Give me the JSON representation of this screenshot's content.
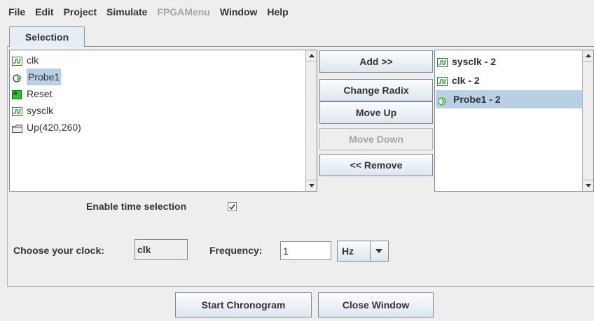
{
  "menu": [
    "File",
    "Edit",
    "Project",
    "Simulate",
    "FPGAMenu",
    "Window",
    "Help"
  ],
  "menu_disabled": [
    "FPGAMenu"
  ],
  "tab": {
    "label": "Selection"
  },
  "left_list": {
    "items": [
      {
        "label": "clk",
        "icon": "clock-signal-icon",
        "selected": false
      },
      {
        "label": "Probe1",
        "icon": "probe-icon",
        "selected": true
      },
      {
        "label": "Reset",
        "icon": "reset-icon",
        "selected": false
      },
      {
        "label": "sysclk",
        "icon": "clock-signal-icon",
        "selected": false
      },
      {
        "label": "Up(420,260)",
        "icon": "folder-icon",
        "selected": false
      }
    ]
  },
  "buttons": {
    "add": "Add >>",
    "change_radix": "Change Radix",
    "move_up": "Move Up",
    "move_down": "Move Down",
    "remove": "<< Remove"
  },
  "right_list": {
    "items": [
      {
        "label": "sysclk - 2",
        "icon": "clock-signal-icon",
        "selected": false
      },
      {
        "label": "clk - 2",
        "icon": "clock-signal-icon",
        "selected": false
      },
      {
        "label": "Probe1 - 2",
        "icon": "probe-icon",
        "selected": true
      }
    ]
  },
  "time_selection": {
    "label": "Enable time selection",
    "checked": true
  },
  "clock": {
    "label": "Choose your clock:",
    "value": "clk"
  },
  "frequency": {
    "label": "Frequency:",
    "value": "1",
    "unit": "Hz"
  },
  "footer": {
    "start": "Start Chronogram",
    "close": "Close Window"
  },
  "colors": {
    "selection": "#b8cfe5",
    "probe_green": "#2aa12a",
    "reset_green": "#22cc22"
  }
}
